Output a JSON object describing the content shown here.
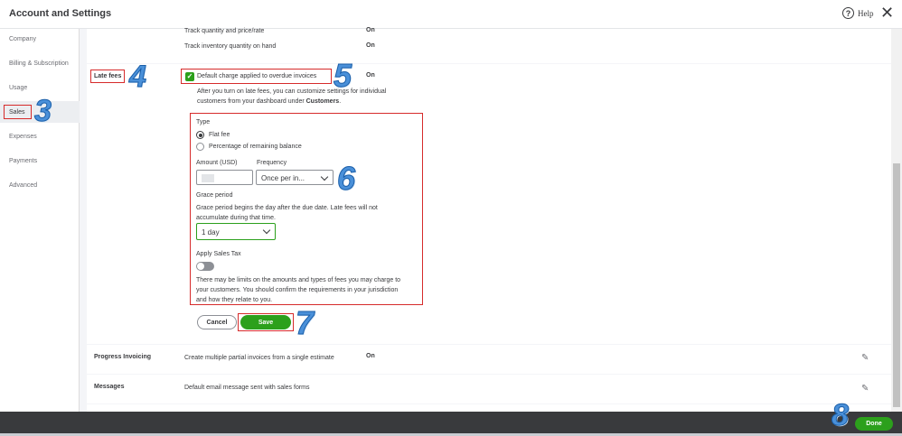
{
  "header": {
    "title": "Account and Settings",
    "help_label": "Help",
    "help_symbol": "?",
    "close_symbol": "✕"
  },
  "sidebar": {
    "items": [
      {
        "label": "Company"
      },
      {
        "label": "Billing & Subscription"
      },
      {
        "label": "Usage"
      },
      {
        "label": "Sales"
      },
      {
        "label": "Expenses"
      },
      {
        "label": "Payments"
      },
      {
        "label": "Advanced"
      }
    ]
  },
  "inventory": {
    "track_qty_price": "Track quantity and price/rate",
    "track_qty_price_value": "On",
    "track_inventory": "Track inventory quantity on hand",
    "track_inventory_value": "On"
  },
  "late_fees": {
    "section_label": "Late fees",
    "checkbox_label": "Default charge applied to overdue invoices",
    "checkbox_checked": true,
    "status": "On",
    "description_1": "After you turn on late fees, you can customize settings for individual",
    "description_2": "customers from your dashboard under ",
    "description_link": "Customers",
    "description_end": ".",
    "type_label": "Type",
    "type_options": [
      "Flat fee",
      "Percentage of remaining balance"
    ],
    "type_selected": "Flat fee",
    "amount_label": "Amount (USD)",
    "amount_value": "",
    "frequency_label": "Frequency",
    "frequency_value": "Once per in...",
    "grace_label": "Grace period",
    "grace_desc_1": "Grace period begins the day after the due date. Late fees will not",
    "grace_desc_2": "accumulate during that time.",
    "grace_value": "1 day",
    "sales_tax_label": "Apply Sales Tax",
    "sales_tax_on": false,
    "limits_1": "There may be limits on the amounts and types of fees you may charge to",
    "limits_2": "your customers. You should confirm the requirements in your jurisdiction",
    "limits_3": "and how they relate to you.",
    "cancel_label": "Cancel",
    "save_label": "Save"
  },
  "progress_invoicing": {
    "label": "Progress Invoicing",
    "description": "Create multiple partial invoices from a single estimate",
    "status": "On"
  },
  "messages": {
    "label": "Messages",
    "description": "Default email message sent with sales forms"
  },
  "footer": {
    "done_label": "Done"
  },
  "annotations": {
    "n3": "3",
    "n4": "4",
    "n5": "5",
    "n6": "6",
    "n7": "7",
    "n8": "8"
  },
  "colors": {
    "accent_green": "#2ca01c",
    "annotation_red": "#d62b2b",
    "annotation_blue": "#4a90d9",
    "footer_bg": "#393a3d"
  }
}
